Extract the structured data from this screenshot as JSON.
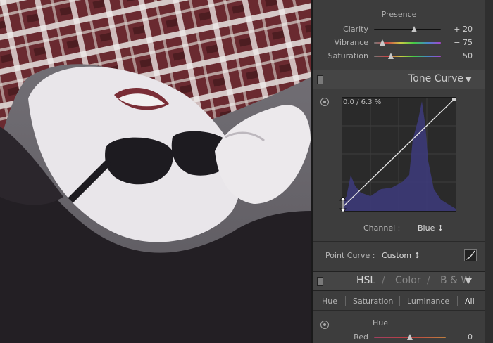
{
  "presence": {
    "title": "Presence",
    "sliders": [
      {
        "label": "Clarity",
        "value": "+ 20",
        "position": 0.6
      },
      {
        "label": "Vibrance",
        "value": "− 75",
        "position": 0.125
      },
      {
        "label": "Saturation",
        "value": "− 50",
        "position": 0.25
      }
    ]
  },
  "tone_curve": {
    "title": "Tone Curve",
    "readout": "0.0 / 6.3 %",
    "channel_label": "Channel :",
    "channel_value": "Blue ↕",
    "point_curve_label": "Point Curve :",
    "point_curve_value": "Custom ↕"
  },
  "hsl": {
    "tabs": [
      "HSL",
      "/",
      "Color",
      "/",
      "B & W"
    ],
    "subtabs": [
      "Hue",
      "Saturation",
      "Luminance",
      "All"
    ],
    "hue_title": "Hue",
    "red_label": "Red",
    "red_value": "0"
  },
  "colors": {
    "panel_bg": "#3a3a3a",
    "histogram": "#3c3a78"
  }
}
